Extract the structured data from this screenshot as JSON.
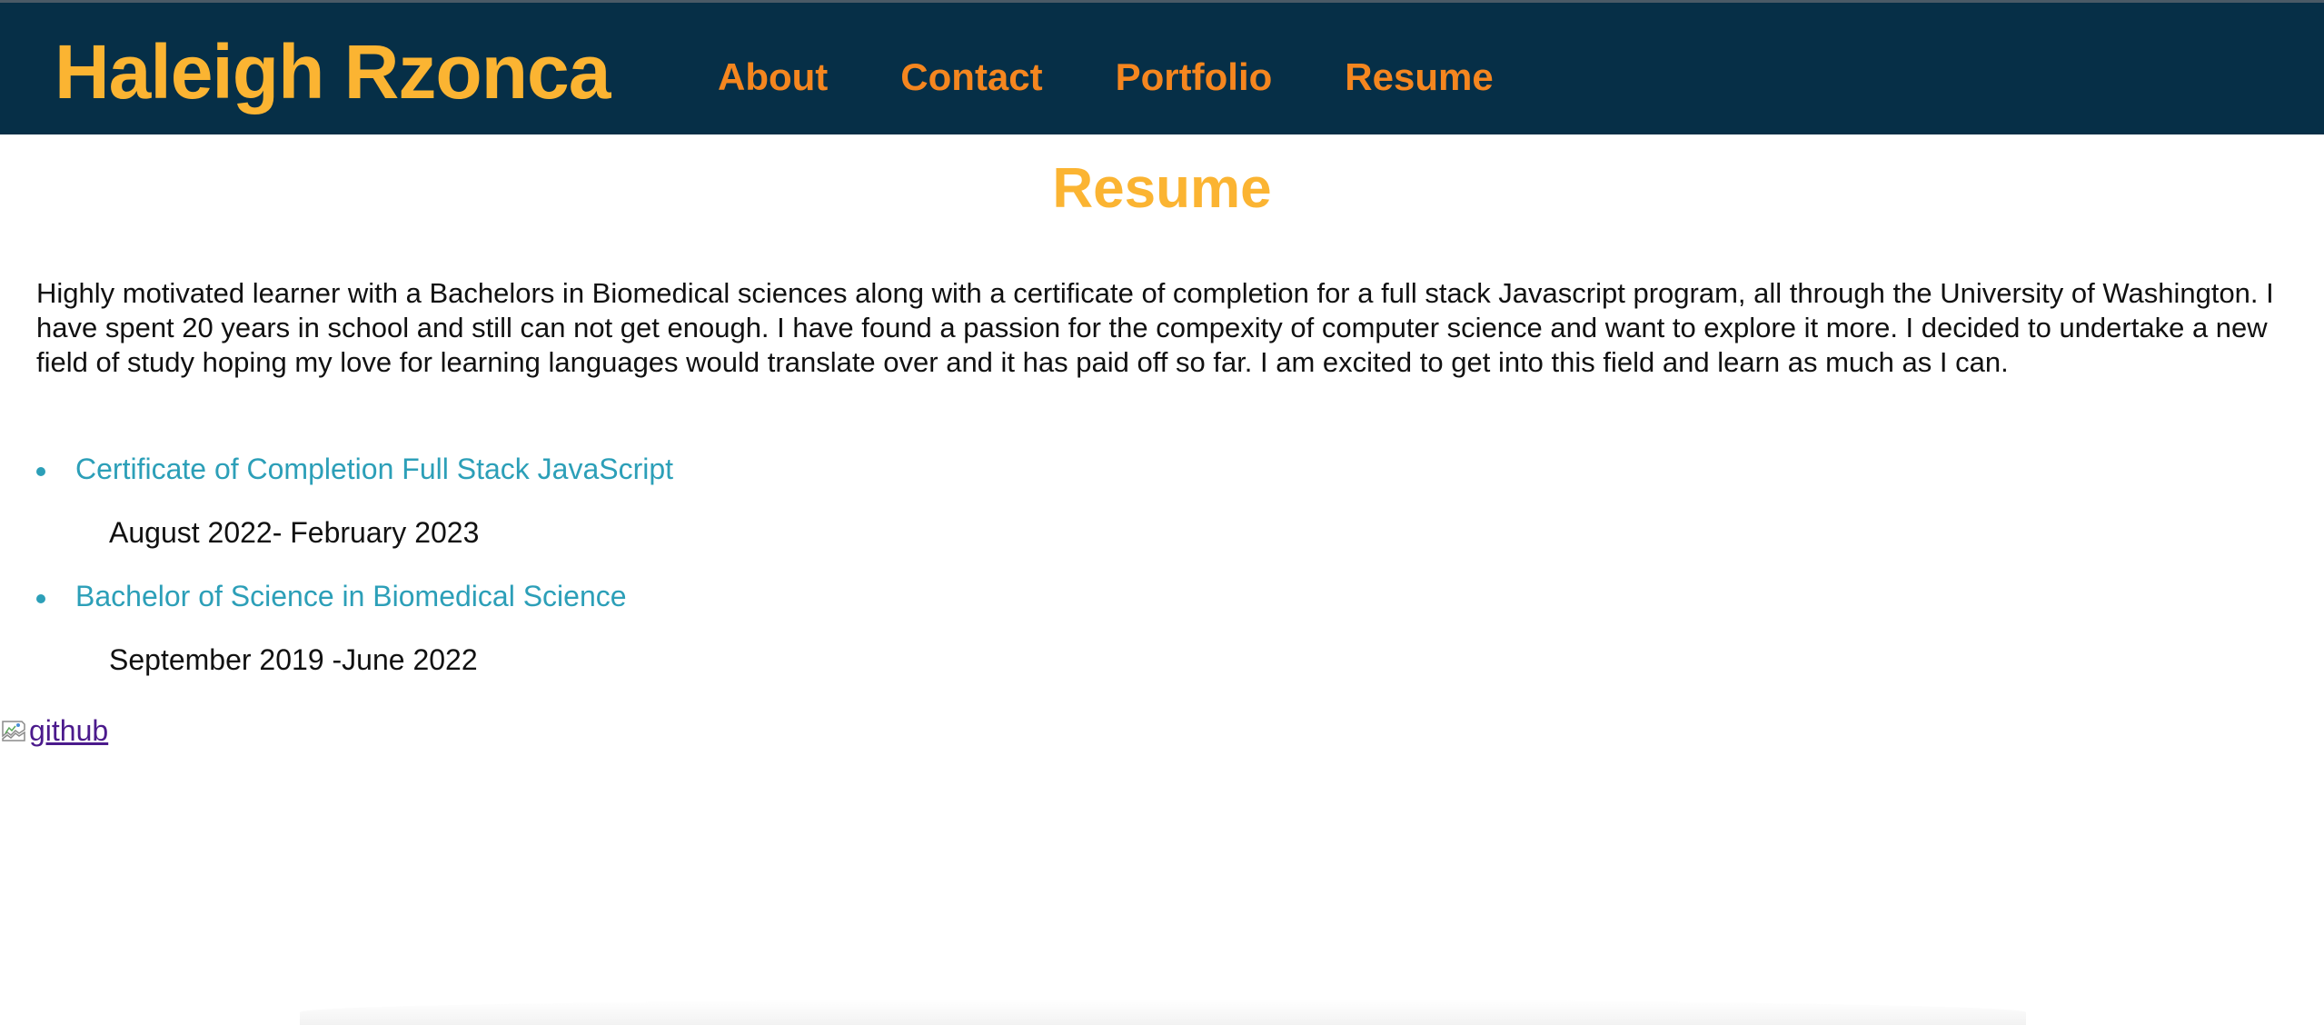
{
  "header": {
    "brand": "Haleigh Rzonca",
    "nav": [
      {
        "label": "About"
      },
      {
        "label": "Contact"
      },
      {
        "label": "Portfolio"
      },
      {
        "label": "Resume"
      }
    ]
  },
  "main": {
    "title": "Resume",
    "intro": "Highly motivated learner with a Bachelors in Biomedical sciences along with a certificate of completion for a full stack Javascript program, all through the University of Washington. I have spent 20 years in school and still can not get enough. I have found a passion for the compexity of computer science and want to explore it more. I decided to undertake a new field of study hoping my love for learning languages would translate over and it has paid off so far. I am excited to get into this field and learn as much as I can.",
    "degrees": [
      {
        "title": "Certificate of Completion Full Stack JavaScript",
        "dates": "August 2022- February 2023"
      },
      {
        "title": "Bachelor of Science in Biomedical Science",
        "dates": "September 2019 -June 2022"
      }
    ]
  },
  "github": {
    "alt_text": "github",
    "icon": "broken-image-icon"
  },
  "colors": {
    "header_bg": "#062f47",
    "brand": "#fbb432",
    "nav": "#f5861f",
    "title": "#fbb432",
    "link": "#2c9fb8",
    "visited_link": "#4b1a8c"
  }
}
